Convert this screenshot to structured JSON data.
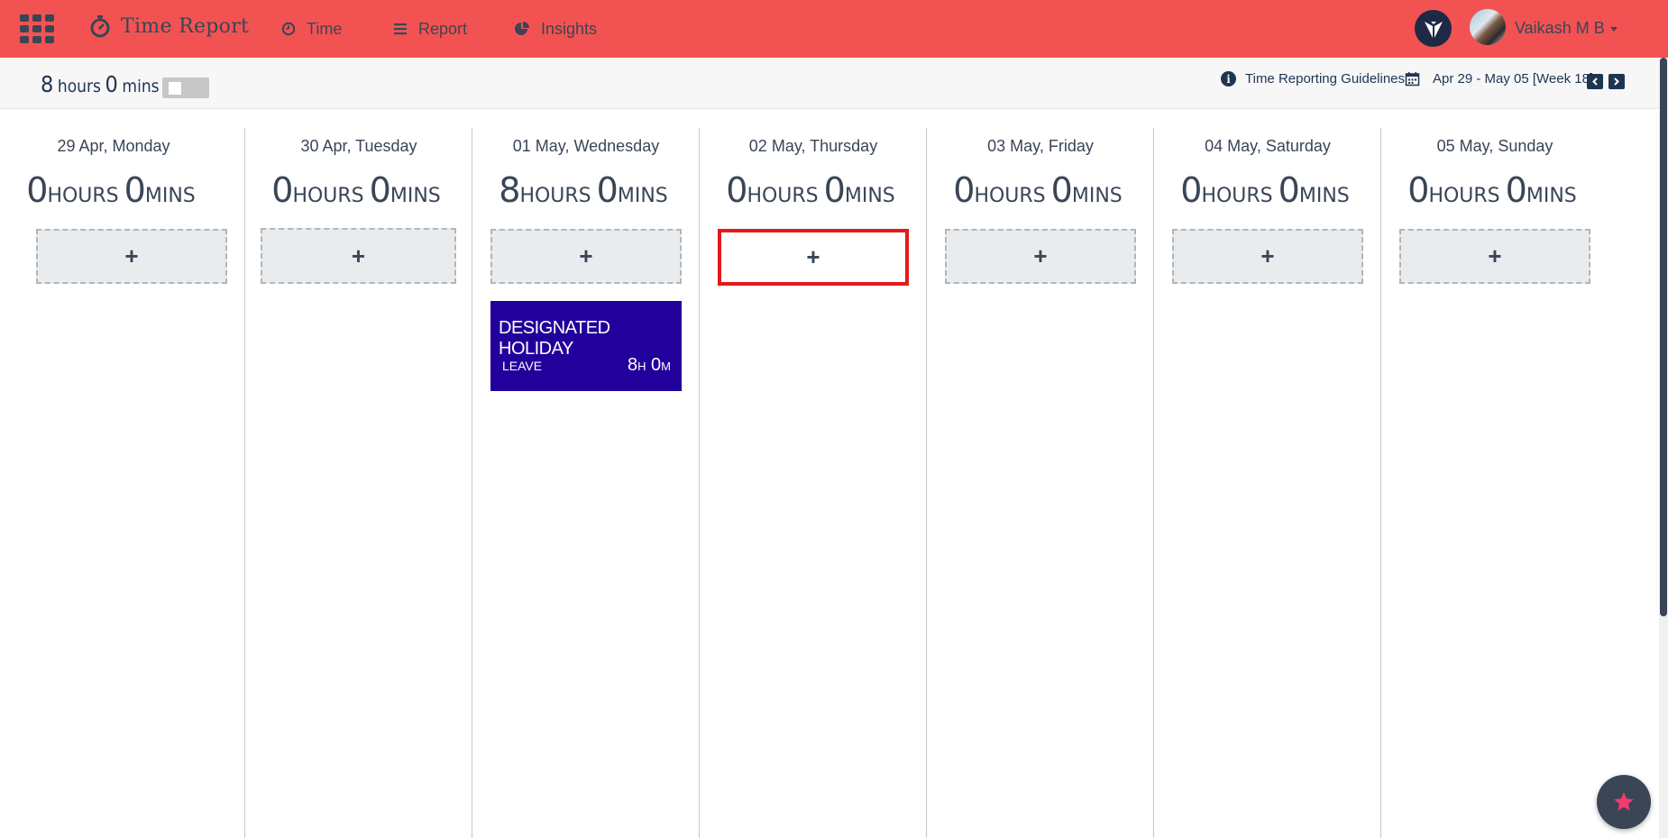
{
  "app": {
    "title": "Time Report"
  },
  "nav": {
    "time": "Time",
    "report": "Report",
    "insights": "Insights"
  },
  "user": {
    "name": "Vaikash M B"
  },
  "summary": {
    "hours": "8",
    "hours_unit": "hours",
    "mins": "0",
    "mins_unit": "mins",
    "toggle_on": false
  },
  "guidelines_label": "Time Reporting Guidelines",
  "date_range": "Apr 29 - May 05 [Week 18]",
  "days": [
    {
      "label": "29 Apr, Monday",
      "hours": "0",
      "mins": "0"
    },
    {
      "label": "30 Apr, Tuesday",
      "hours": "0",
      "mins": "0"
    },
    {
      "label": "01 May, Wednesday",
      "hours": "8",
      "mins": "0"
    },
    {
      "label": "02 May, Thursday",
      "hours": "0",
      "mins": "0"
    },
    {
      "label": "03 May, Friday",
      "hours": "0",
      "mins": "0"
    },
    {
      "label": "04 May, Saturday",
      "hours": "0",
      "mins": "0"
    },
    {
      "label": "05 May, Sunday",
      "hours": "0",
      "mins": "0"
    }
  ],
  "units": {
    "hours": "HOURS",
    "mins": "MINS",
    "h": "H",
    "m": "M"
  },
  "add_label": "+",
  "entry": {
    "title": "DESIGNATED HOLIDAY",
    "type": "LEAVE",
    "hours": "8",
    "mins": "0"
  },
  "colors": {
    "topbar": "#f25352",
    "text_dark": "#3a4556",
    "navy": "#1e3552",
    "entry_bg": "#22009b",
    "selected_border": "#e21a1a",
    "fab_star": "#f23b6e"
  }
}
